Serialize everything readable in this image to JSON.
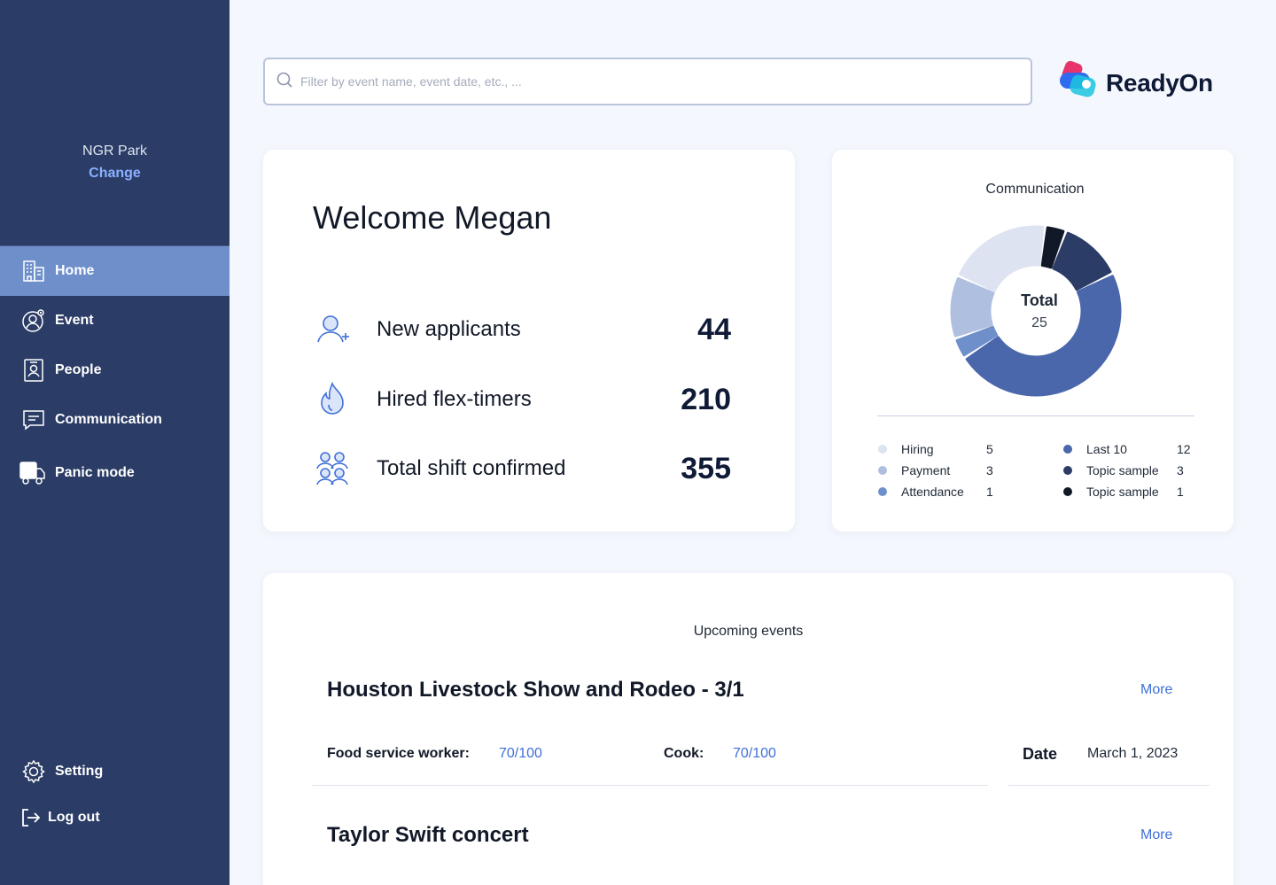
{
  "sidebar": {
    "org_name": "NGR Park",
    "org_change": "Change",
    "items": [
      {
        "label": "Home",
        "icon": "building-icon",
        "active": true
      },
      {
        "label": "Event",
        "icon": "event-icon"
      },
      {
        "label": "People",
        "icon": "badge-icon"
      },
      {
        "label": "Communication",
        "icon": "message-icon"
      },
      {
        "label": "Panic mode",
        "icon": "truck-icon"
      }
    ],
    "bottom_items": [
      {
        "label": "Setting",
        "icon": "gear-icon"
      },
      {
        "label": "Log out",
        "icon": "logout-icon"
      }
    ]
  },
  "search": {
    "placeholder": "Filter by event name, event date, etc., ..."
  },
  "brand": {
    "name": "ReadyOn",
    "colors": [
      "#e8336d",
      "#2f6bf0",
      "#1bc6e0"
    ]
  },
  "welcome": {
    "title": "Welcome Megan",
    "stats": [
      {
        "label": "New applicants",
        "value": "44",
        "icon": "add-user-icon"
      },
      {
        "label": "Hired flex-timers",
        "value": "210",
        "icon": "flame-icon"
      },
      {
        "label": "Total shift confirmed",
        "value": "355",
        "icon": "group-icon"
      }
    ]
  },
  "communication": {
    "title": "Communication",
    "total_label": "Total",
    "total_value": "25",
    "legend_left": [
      {
        "name": "Hiring",
        "value": "5",
        "color": "#dde3f0"
      },
      {
        "name": "Payment",
        "value": "3",
        "color": "#aebfe0"
      },
      {
        "name": "Attendance",
        "value": "1",
        "color": "#6f8fcb"
      }
    ],
    "legend_right": [
      {
        "name": "Last 10",
        "value": "12",
        "color": "#4a67ab"
      },
      {
        "name": "Topic sample",
        "value": "3",
        "color": "#2b3c66"
      },
      {
        "name": "Topic sample",
        "value": "1",
        "color": "#111827"
      }
    ]
  },
  "events": {
    "title": "Upcoming events",
    "more_label": "More",
    "items": [
      {
        "name": "Houston Livestock Show and Rodeo - 3/1",
        "roles": [
          {
            "label": "Food service worker:",
            "count": "70/100"
          },
          {
            "label": "Cook:",
            "count": "70/100"
          }
        ],
        "date_label": "Date",
        "date": "March 1, 2023"
      },
      {
        "name": "Taylor Swift concert"
      }
    ]
  }
}
